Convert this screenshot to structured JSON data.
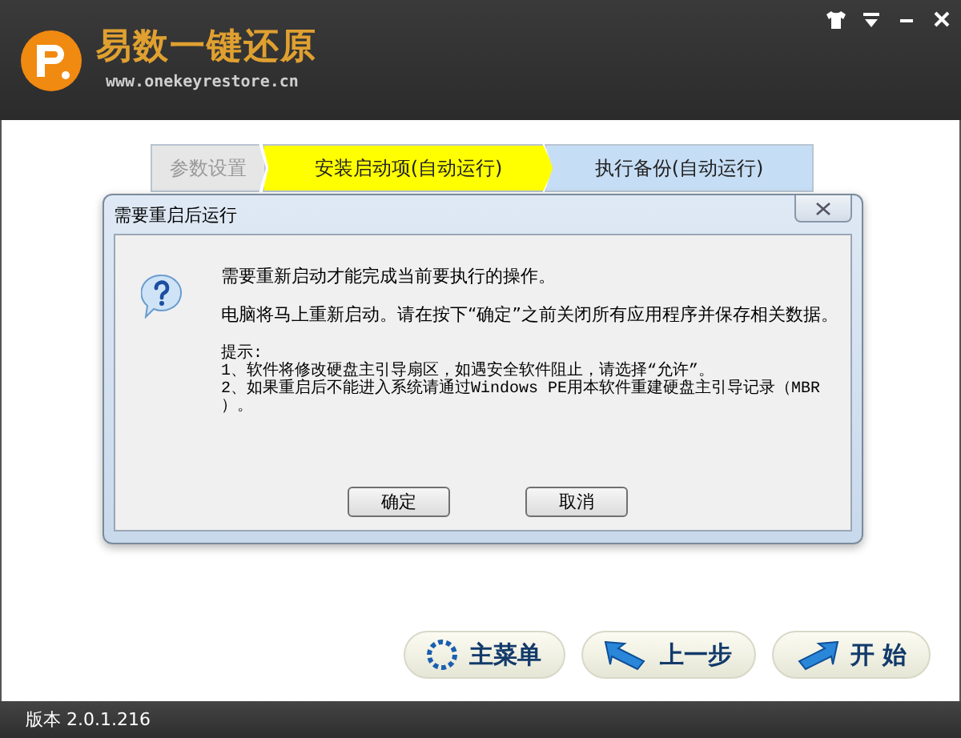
{
  "header": {
    "title": "易数一键还原",
    "url": "www.onekeyrestore.cn"
  },
  "steps": [
    {
      "label": "参数设置",
      "completed": true,
      "selected": false
    },
    {
      "label": "安装启动项(自动运行)",
      "completed": false,
      "selected": true
    },
    {
      "label": "执行备份(自动运行)",
      "completed": false,
      "selected": false
    }
  ],
  "dialog": {
    "title": "需要重启后运行",
    "messages": [
      "需要重新启动才能完成当前要执行的操作。",
      "电脑将马上重新启动。请在按下“确定”之前关闭所有应用程序并保存相关数据。"
    ],
    "hint_lines": [
      "提示:",
      "1、软件将修改硬盘主引导扇区，如遇安全软件阻止，请选择“允许”。",
      "2、如果重启后不能进入系统请通过Windows PE用本软件重建硬盘主引导记录（MBR",
      "）。"
    ],
    "buttons": [
      "确定",
      "取消"
    ]
  },
  "nav_buttons": [
    {
      "label": "主菜单",
      "kind": "menu"
    },
    {
      "label": "上一步",
      "kind": "back"
    },
    {
      "label": "开 始",
      "kind": "start"
    }
  ],
  "status_bar": {
    "version": "版本 2.0.1.216"
  }
}
